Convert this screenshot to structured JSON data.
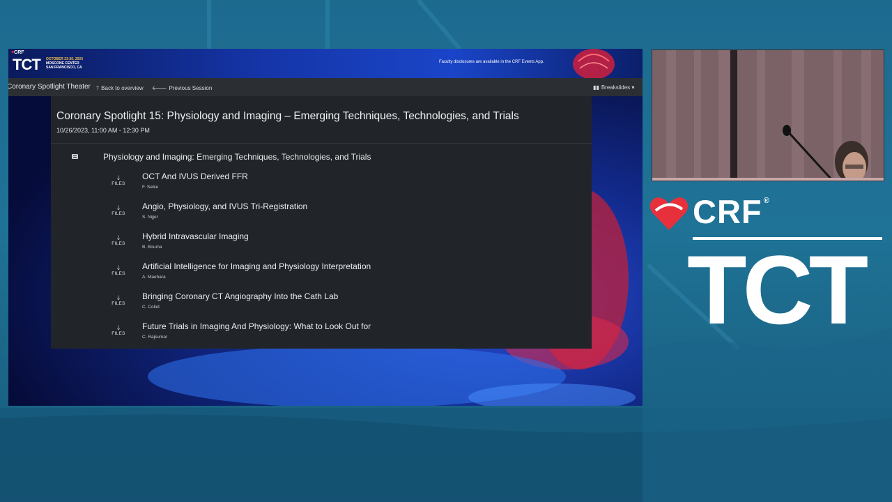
{
  "banner": {
    "crf_mark": "CRF",
    "tct_mark": "TCT",
    "event_dates": "OCTOBER 23-26, 2023",
    "event_venue": "MOSCONE CENTER",
    "event_city": "SAN FRANCISCO, CA",
    "disclosure": "Faculty disclosures are available in the CRF Events App."
  },
  "navbar": {
    "theater_title": "Coronary Spotlight Theater",
    "back_label": "Back to overview",
    "prev_label": "Previous Session",
    "breakslides_label": "Breakslides"
  },
  "session": {
    "title": "Coronary Spotlight 15: Physiology and Imaging – Emerging Techniques, Technologies, and Trials",
    "datetime": "10/26/2023, 11:00 AM - 12:30 PM",
    "module_title": "Physiology and Imaging: Emerging Techniques, Technologies, and Trials",
    "files_label": "FILES",
    "talks": [
      {
        "title": "OCT And IVUS Derived FFR",
        "speaker": "F. Seike"
      },
      {
        "title": "Angio, Physiology, and IVUS Tri-Registration",
        "speaker": "S. Nijjer"
      },
      {
        "title": "Hybrid Intravascular Imaging",
        "speaker": "B. Bouma"
      },
      {
        "title": "Artificial Intelligence for Imaging and Physiology Interpretation",
        "speaker": "A. Maehara"
      },
      {
        "title": "Bringing Coronary CT Angiography Into the Cath Lab",
        "speaker": "C. Collet"
      },
      {
        "title": "Future Trials in Imaging And Physiology: What to Look Out for",
        "speaker": "C. Rajkumar"
      }
    ]
  },
  "brand": {
    "crf": "CRF",
    "registered": "®",
    "tct": "TCT"
  },
  "colors": {
    "stage_bg": "#1f7396",
    "content_bg": "#212529",
    "navbar_bg": "#2b2f33",
    "heart_red": "#e8303c"
  }
}
